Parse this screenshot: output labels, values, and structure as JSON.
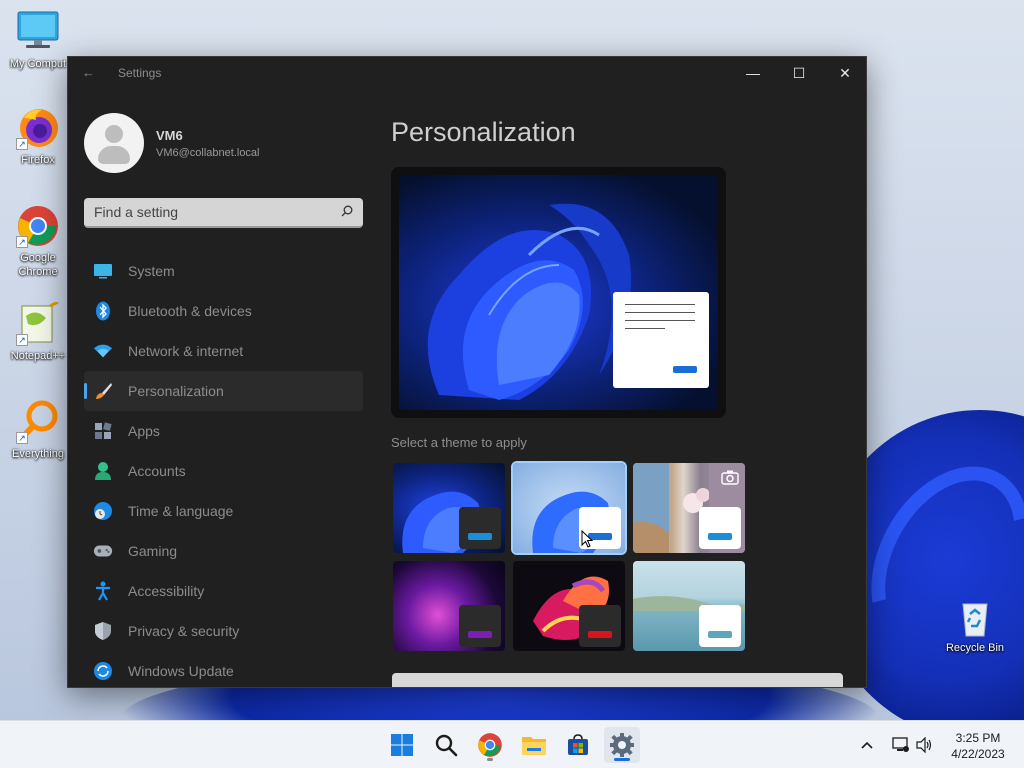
{
  "desktop": {
    "icons": [
      {
        "label": "My Comput",
        "icon": "computer-icon"
      },
      {
        "label": "Firefox",
        "icon": "firefox-icon"
      },
      {
        "label": "Google Chrome",
        "icon": "chrome-icon"
      },
      {
        "label": "Notepad++",
        "icon": "notepad-plus-plus-icon"
      },
      {
        "label": "Everything",
        "icon": "everything-search-icon"
      }
    ],
    "recycle_bin": {
      "label": "Recycle Bin",
      "icon": "recycle-bin-icon"
    }
  },
  "window": {
    "title": "Settings",
    "controls": {
      "minimize": "—",
      "maximize": "☐",
      "close": "✕"
    },
    "user": {
      "name": "VM6",
      "email": "VM6@collabnet.local"
    },
    "search": {
      "placeholder": "Find a setting"
    },
    "nav": [
      {
        "label": "System",
        "icon": "system-icon",
        "active": false
      },
      {
        "label": "Bluetooth & devices",
        "icon": "bluetooth-icon",
        "active": false
      },
      {
        "label": "Network & internet",
        "icon": "wifi-icon",
        "active": false
      },
      {
        "label": "Personalization",
        "icon": "brush-icon",
        "active": true
      },
      {
        "label": "Apps",
        "icon": "apps-icon",
        "active": false
      },
      {
        "label": "Accounts",
        "icon": "accounts-icon",
        "active": false
      },
      {
        "label": "Time & language",
        "icon": "time-language-icon",
        "active": false
      },
      {
        "label": "Gaming",
        "icon": "gaming-icon",
        "active": false
      },
      {
        "label": "Accessibility",
        "icon": "accessibility-icon",
        "active": false
      },
      {
        "label": "Privacy & security",
        "icon": "shield-icon",
        "active": false
      },
      {
        "label": "Windows Update",
        "icon": "update-icon",
        "active": false
      }
    ],
    "content": {
      "title": "Personalization",
      "themes_caption": "Select a theme to apply",
      "themes": [
        {
          "name": "windows-dark",
          "accent": "#1a8fd8",
          "selected": false
        },
        {
          "name": "windows-light",
          "accent": "#1a6ed8",
          "selected": true
        },
        {
          "name": "windows-spotlight",
          "accent": "#1a8fd8",
          "selected": false
        },
        {
          "name": "glow",
          "accent": "#7a1fb0",
          "selected": false
        },
        {
          "name": "captured-motion",
          "accent": "#d8141e",
          "selected": false
        },
        {
          "name": "flow",
          "accent": "#5aa8b8",
          "selected": false
        }
      ]
    }
  },
  "taskbar": {
    "apps": [
      {
        "name": "start-icon"
      },
      {
        "name": "search-icon"
      },
      {
        "name": "chrome-icon"
      },
      {
        "name": "file-explorer-icon"
      },
      {
        "name": "store-icon"
      },
      {
        "name": "settings-icon"
      }
    ],
    "clock": {
      "time": "3:25 PM",
      "date": "4/22/2023"
    }
  }
}
